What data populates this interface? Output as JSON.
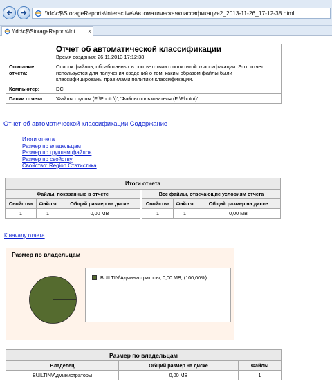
{
  "browser": {
    "url": "\\\\dc\\c$\\StorageReports\\Interactive\\Автоматическаяклассификация2_2013-11-26_17-12-38.html",
    "tab_title": "\\\\dc\\c$\\StorageReports\\Int...",
    "tab_close": "×"
  },
  "report": {
    "title": "Отчет об автоматической классификации",
    "created": "Время создания: 26.11.2013 17:12:38",
    "rows": [
      {
        "label": "Описание отчета:",
        "value": "Список файлов, обработанных в соответствии с политикой классификации. Этот отчет используется для получения сведений о том, каким образом файлы были классифицированы правилами политики классификации."
      },
      {
        "label": "Компьютер:",
        "value": "DC"
      },
      {
        "label": "Папки отчета:",
        "value": "'Файлы группы (F:\\Photo\\)', 'Файлы пользователя (F:\\Photo\\)'"
      }
    ]
  },
  "contents_link": "Отчет об автоматической классификации Содержание",
  "toc": [
    "Итоги отчета",
    "Размер по владельцам",
    "Размер по группам файлов",
    "Размер по свойству",
    "Свойство: Region Статистика"
  ],
  "summary": {
    "caption": "Итоги отчета",
    "group_left": "Файлы, показанные в отчете",
    "group_right": "Все файлы, отвечающие условиям отчета",
    "columns": [
      "Свойства",
      "Файлы",
      "Общий размер на диске"
    ],
    "left_values": [
      "1",
      "1",
      "0,00 MB"
    ],
    "right_values": [
      "1",
      "1",
      "0,00 MB"
    ]
  },
  "top_link": "К началу отчета",
  "owner_chart": {
    "title": "Размер по владельцам",
    "legend_entry": "BUILTIN\\Администраторы; 0,00 MB; (100,00%)",
    "slice_color": "#556b2f"
  },
  "chart_data": {
    "type": "pie",
    "title": "Размер по владельцам",
    "categories": [
      "BUILTIN\\Администраторы"
    ],
    "values": [
      100.0
    ],
    "legend": "right"
  },
  "owners_table": {
    "caption": "Размер по владельцам",
    "columns": [
      "Владелец",
      "Общий размер на диске",
      "Файлы"
    ],
    "row": [
      "BUILTIN\\Администраторы",
      "0,00 MB",
      "1"
    ]
  }
}
